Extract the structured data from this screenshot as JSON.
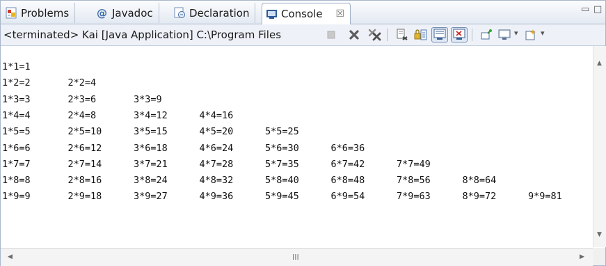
{
  "tabs": [
    {
      "label": "Problems",
      "icon": "problems-icon"
    },
    {
      "label": "Javadoc",
      "icon": "javadoc-at-icon"
    },
    {
      "label": "Declaration",
      "icon": "declaration-icon"
    },
    {
      "label": "Console",
      "icon": "console-icon",
      "close": "☒"
    }
  ],
  "window_controls": {
    "minimize": "▭",
    "maximize": "□"
  },
  "toolbar": {
    "status": "<terminated> Kai [Java Application] C:\\Program Files",
    "buttons": [
      {
        "name": "terminate-button",
        "icon": "stop-square-icon"
      },
      {
        "name": "remove-launch-button",
        "icon": "x-icon"
      },
      {
        "name": "remove-all-terminated-button",
        "icon": "double-x-icon"
      },
      {
        "name": "clear-console-button",
        "icon": "clear-icon"
      },
      {
        "name": "scroll-lock-button",
        "icon": "scroll-lock-icon"
      },
      {
        "name": "show-on-stdout-button",
        "icon": "stdout-icon"
      },
      {
        "name": "show-on-stderr-button",
        "icon": "stderr-icon"
      },
      {
        "name": "pin-console-button",
        "icon": "pin-icon"
      },
      {
        "name": "display-console-button",
        "icon": "monitor-icon"
      },
      {
        "name": "open-console-button",
        "icon": "new-console-icon"
      }
    ],
    "dropdown_arrow": "▾"
  },
  "console_output": [
    [
      "1*1=1"
    ],
    [
      "1*2=2",
      "2*2=4"
    ],
    [
      "1*3=3",
      "2*3=6",
      "3*3=9"
    ],
    [
      "1*4=4",
      "2*4=8",
      "3*4=12",
      "4*4=16"
    ],
    [
      "1*5=5",
      "2*5=10",
      "3*5=15",
      "4*5=20",
      "5*5=25"
    ],
    [
      "1*6=6",
      "2*6=12",
      "3*6=18",
      "4*6=24",
      "5*6=30",
      "6*6=36"
    ],
    [
      "1*7=7",
      "2*7=14",
      "3*7=21",
      "4*7=28",
      "5*7=35",
      "6*7=42",
      "7*7=49"
    ],
    [
      "1*8=8",
      "2*8=16",
      "3*8=24",
      "4*8=32",
      "5*8=40",
      "6*8=48",
      "7*8=56",
      "8*8=64"
    ],
    [
      "1*9=9",
      "2*9=18",
      "3*9=27",
      "4*9=36",
      "5*9=45",
      "6*9=54",
      "7*9=63",
      "8*9=72",
      "9*9=81"
    ]
  ],
  "scrollbars": {
    "grip": "III",
    "up": "▲",
    "down": "▼",
    "left": "◀",
    "right": "▶"
  }
}
